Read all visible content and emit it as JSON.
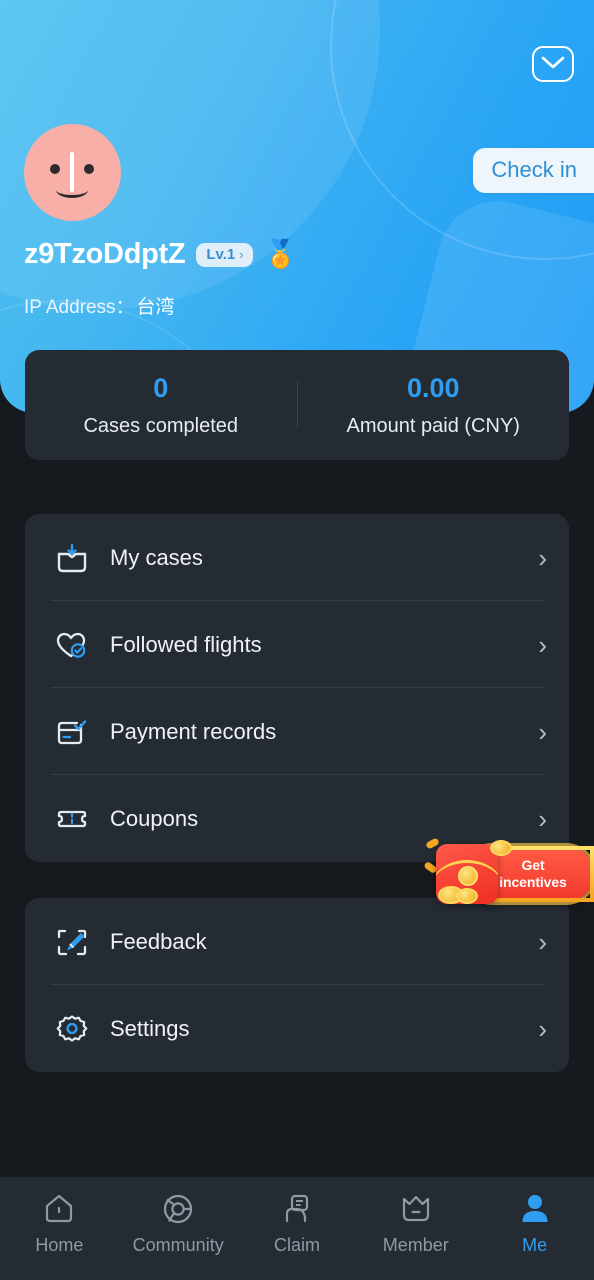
{
  "colors": {
    "header_light": "#4ec1f2",
    "header_dark": "#1d9cf6",
    "page_bg": "#16191d",
    "card_bg": "#242b33",
    "accent": "#2f9ef0",
    "avatar": "#f7afa7",
    "incentive_red": "#f23a2e",
    "incentive_gold": "#ffd34d"
  },
  "header": {
    "mail_icon": "mail-envelope-icon",
    "checkin_label": "Check in",
    "avatar_icon": "avatar-face-icon",
    "username": "z9TzoDdptZ",
    "level_label": "Lv.1",
    "level_chevron": "›",
    "medal_icon": "🏅",
    "ip_label": "IP Address：",
    "ip_value": "台湾"
  },
  "stats": [
    {
      "value": "0",
      "label": "Cases completed"
    },
    {
      "value": "0.00",
      "label": "Amount paid (CNY)"
    }
  ],
  "menu_primary": [
    {
      "label": "My cases",
      "icon": "inbox-download-icon",
      "chevron": "›"
    },
    {
      "label": "Followed flights",
      "icon": "heart-check-icon",
      "chevron": "›"
    },
    {
      "label": "Payment records",
      "icon": "card-check-icon",
      "chevron": "›"
    },
    {
      "label": "Coupons",
      "icon": "ticket-icon",
      "chevron": "›"
    }
  ],
  "menu_secondary": [
    {
      "label": "Feedback",
      "icon": "paintbrush-icon",
      "chevron": "›"
    },
    {
      "label": "Settings",
      "icon": "gear-icon",
      "chevron": "›"
    }
  ],
  "incentive": {
    "line1": "Get",
    "line2": "incentives",
    "icon": "red-envelope-icon"
  },
  "bottom_nav": [
    {
      "label": "Home",
      "icon": "home-icon",
      "active": false
    },
    {
      "label": "Community",
      "icon": "community-swirl-icon",
      "active": false
    },
    {
      "label": "Claim",
      "icon": "claim-document-icon",
      "active": false
    },
    {
      "label": "Member",
      "icon": "crown-icon",
      "active": false
    },
    {
      "label": "Me",
      "icon": "person-icon",
      "active": true
    }
  ]
}
